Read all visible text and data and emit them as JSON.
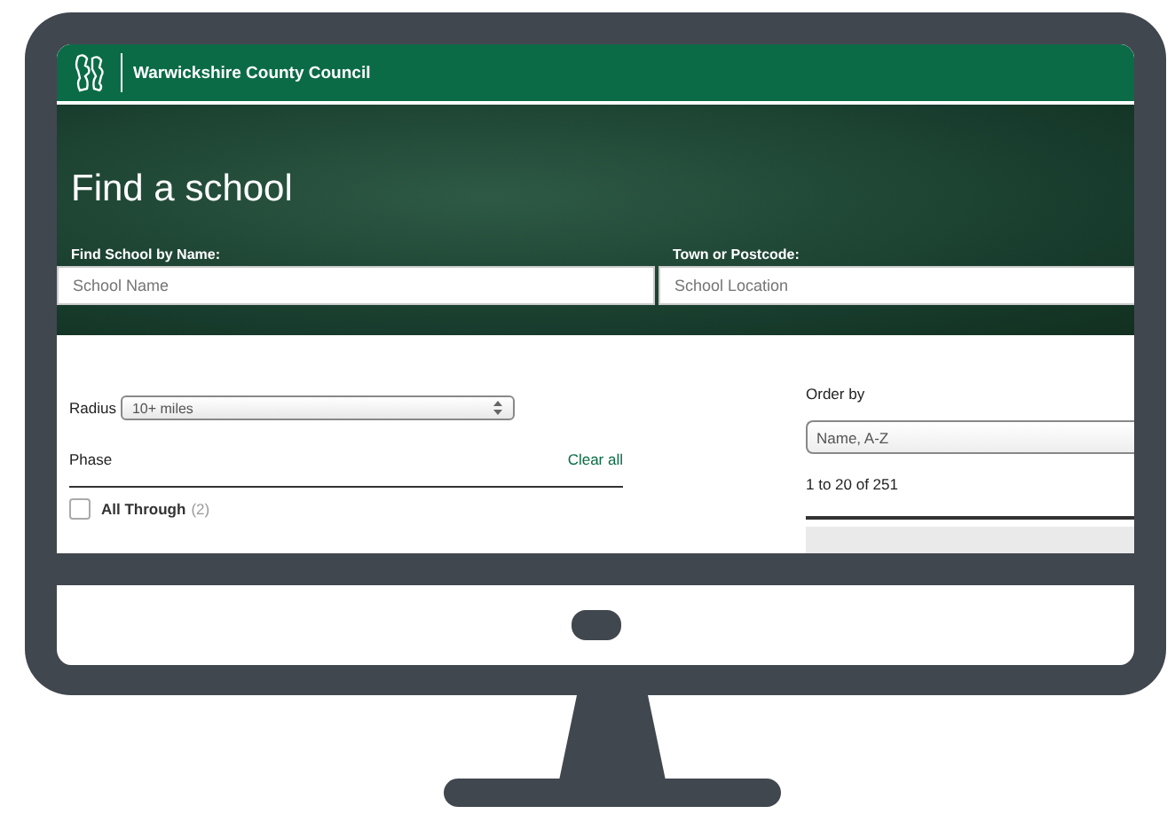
{
  "header": {
    "org_name": "Warwickshire County Council"
  },
  "hero": {
    "title": "Find a school",
    "fields": [
      {
        "label": "Find School by Name:",
        "placeholder": "School Name"
      },
      {
        "label": "Town or Postcode:",
        "placeholder": "School Location"
      }
    ]
  },
  "filters": {
    "radius": {
      "label": "Radius",
      "value": "10+ miles"
    },
    "phase": {
      "title": "Phase",
      "clear": "Clear all",
      "options": [
        {
          "label": "All Through",
          "count": "(2)",
          "checked": false
        }
      ]
    }
  },
  "results": {
    "order_label": "Order by",
    "order_value": "Name, A-Z",
    "summary": "1 to 20 of 251"
  }
}
